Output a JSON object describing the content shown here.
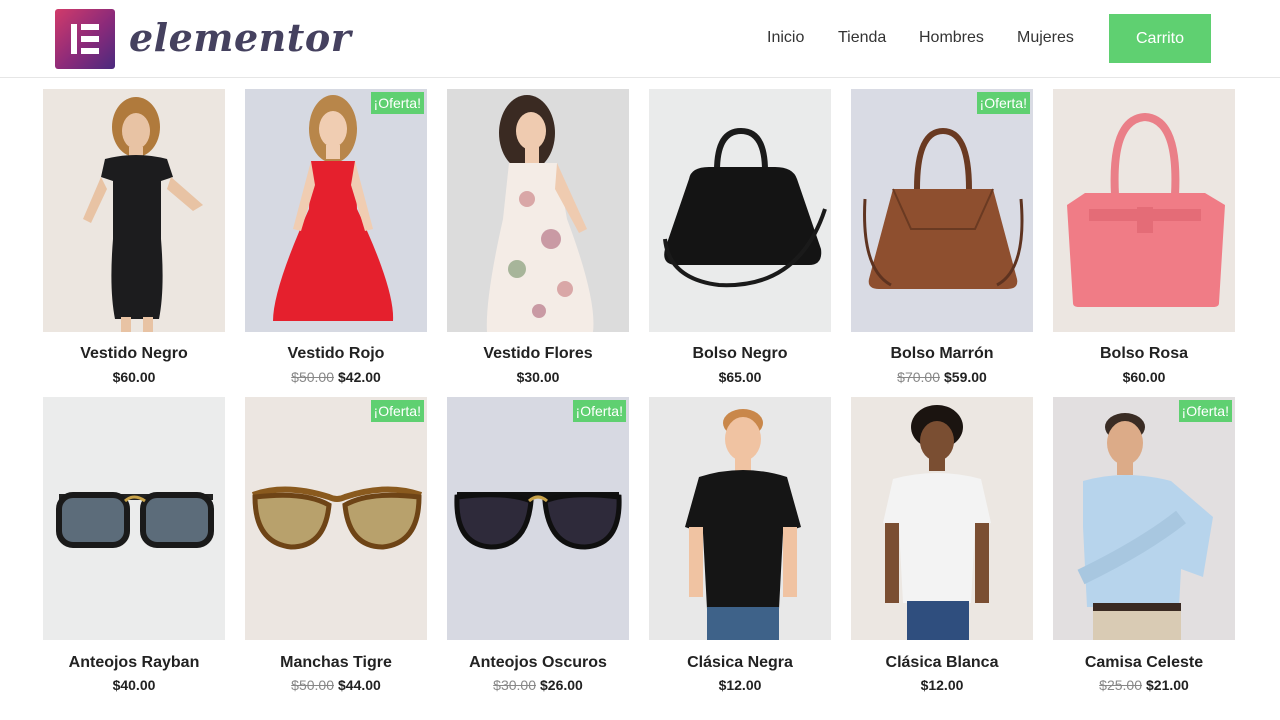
{
  "brand": {
    "name": "elementor"
  },
  "nav": {
    "items": [
      "Inicio",
      "Tienda",
      "Hombres",
      "Mujeres"
    ],
    "cart_label": "Carrito"
  },
  "colors": {
    "accent": "#5fd071",
    "logo_start": "#d13b6a",
    "logo_end": "#4a2a7e"
  },
  "badge_label": "¡Oferta!",
  "products": [
    {
      "name": "Vestido Negro",
      "price": "$60.00",
      "old_price": "",
      "sale": false,
      "icon": "black-dress"
    },
    {
      "name": "Vestido Rojo",
      "price": "$42.00",
      "old_price": "$50.00",
      "sale": true,
      "icon": "red-dress"
    },
    {
      "name": "Vestido Flores",
      "price": "$30.00",
      "old_price": "",
      "sale": false,
      "icon": "floral-dress"
    },
    {
      "name": "Bolso Negro",
      "price": "$65.00",
      "old_price": "",
      "sale": false,
      "icon": "black-bag"
    },
    {
      "name": "Bolso Marrón",
      "price": "$59.00",
      "old_price": "$70.00",
      "sale": true,
      "icon": "brown-bag"
    },
    {
      "name": "Bolso Rosa",
      "price": "$60.00",
      "old_price": "",
      "sale": false,
      "icon": "pink-bag"
    },
    {
      "name": "Anteojos Rayban",
      "price": "$40.00",
      "old_price": "",
      "sale": false,
      "icon": "black-sunglasses"
    },
    {
      "name": "Manchas Tigre",
      "price": "$44.00",
      "old_price": "$50.00",
      "sale": true,
      "icon": "tortoise-sunglasses"
    },
    {
      "name": "Anteojos Oscuros",
      "price": "$26.00",
      "old_price": "$30.00",
      "sale": true,
      "icon": "dark-sunglasses"
    },
    {
      "name": "Clásica Negra",
      "price": "$12.00",
      "old_price": "",
      "sale": false,
      "icon": "black-tshirt-man"
    },
    {
      "name": "Clásica Blanca",
      "price": "$12.00",
      "old_price": "",
      "sale": false,
      "icon": "white-tshirt-man"
    },
    {
      "name": "Camisa Celeste",
      "price": "$21.00",
      "old_price": "$25.00",
      "sale": true,
      "icon": "blue-shirt-man"
    }
  ]
}
